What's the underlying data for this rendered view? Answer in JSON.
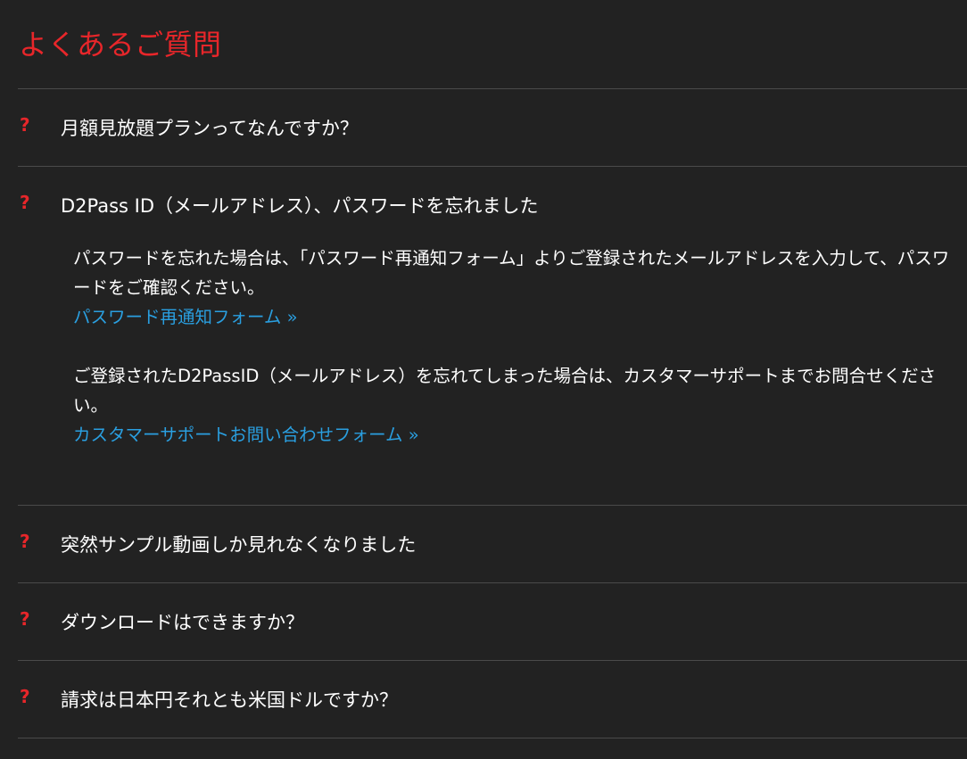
{
  "faq": {
    "title": "よくあるご質問",
    "question_mark": "?",
    "items": [
      {
        "question": "月額見放題プランってなんですか？"
      },
      {
        "question": "D2Pass ID（メールアドレス）、パスワードを忘れました",
        "answer": {
          "p1": "パスワードを忘れた場合は、「パスワード再通知フォーム」よりご登録されたメールアドレスを入力して、パスワードをご確認ください。",
          "link1": "パスワード再通知フォーム »",
          "p2": "ご登録されたD2PassID（メールアドレス）を忘れてしまった場合は、カスタマーサポートまでお問合せください。",
          "link2": "カスタマーサポートお問い合わせフォーム »"
        }
      },
      {
        "question": "突然サンプル動画しか見れなくなりました"
      },
      {
        "question": "ダウンロードはできますか？"
      },
      {
        "question": "請求は日本円それとも米国ドルですか？"
      }
    ]
  },
  "colors": {
    "background": "#222222",
    "accent_red": "#e8262a",
    "link_blue": "#2a9fe0",
    "divider": "#4a4a4a"
  }
}
